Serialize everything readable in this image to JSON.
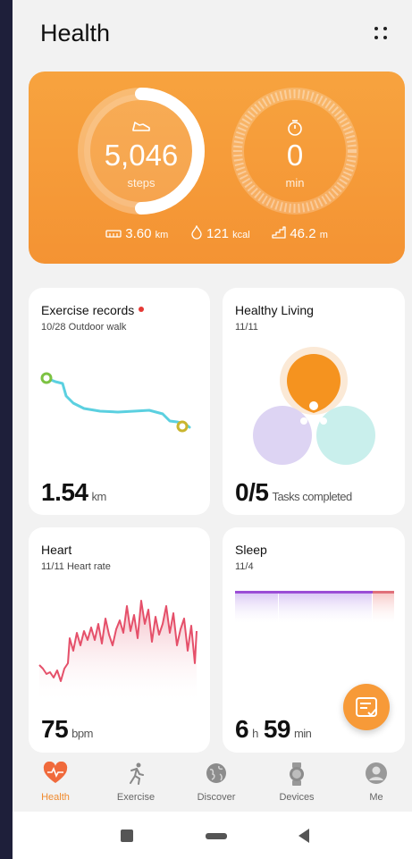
{
  "header": {
    "title": "Health"
  },
  "summary": {
    "steps": "5,046",
    "steps_unit": "steps",
    "steps_progress": 0.5,
    "minutes": "0",
    "minutes_unit": "min",
    "distance": "3.60",
    "distance_unit": "km",
    "calories": "121",
    "calories_unit": "kcal",
    "climb": "46.2",
    "climb_unit": "m"
  },
  "cards": {
    "exercise": {
      "title": "Exercise records",
      "subtitle": "10/28 Outdoor walk",
      "value": "1.54",
      "unit": "km"
    },
    "living": {
      "title": "Healthy Living",
      "subtitle": "11/11",
      "value": "0/5",
      "unit": "Tasks completed"
    },
    "heart": {
      "title": "Heart",
      "subtitle": "11/11 Heart rate",
      "value": "75",
      "unit": "bpm"
    },
    "sleep": {
      "title": "Sleep",
      "subtitle": "11/4",
      "hours": "6",
      "hours_unit": "h",
      "minutes": "59",
      "minutes_unit": "min"
    }
  },
  "tabs": [
    {
      "label": "Health",
      "icon": "heart-pulse-icon",
      "active": true
    },
    {
      "label": "Exercise",
      "icon": "running-icon",
      "active": false
    },
    {
      "label": "Discover",
      "icon": "globe-icon",
      "active": false
    },
    {
      "label": "Devices",
      "icon": "watch-icon",
      "active": false
    },
    {
      "label": "Me",
      "icon": "avatar-icon",
      "active": false
    }
  ],
  "colors": {
    "accent": "#f49333",
    "heart_line": "#e5506a",
    "route": "#5bd0e0",
    "sleep_bar": "#9b4dd6"
  }
}
